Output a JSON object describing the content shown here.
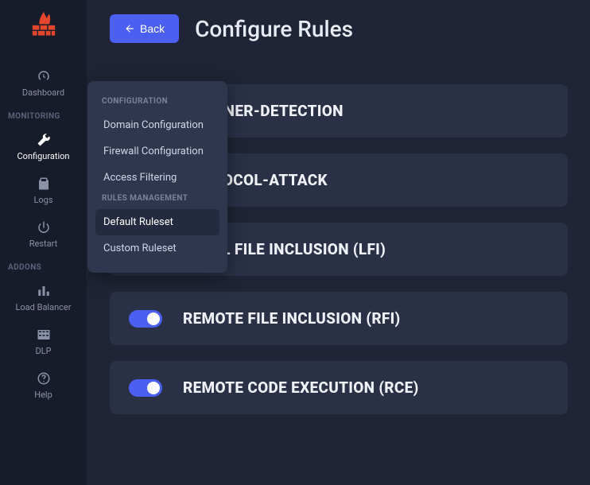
{
  "sidebar": {
    "items": [
      {
        "label": "Dashboard"
      },
      {
        "label": "Configuration"
      },
      {
        "label": "Logs"
      },
      {
        "label": "Restart"
      },
      {
        "label": "Load Balancer"
      },
      {
        "label": "DLP"
      },
      {
        "label": "Help"
      }
    ],
    "sections": {
      "monitoring": "MONITORING",
      "addons": "ADDONS"
    }
  },
  "header": {
    "back_label": "Back",
    "title": "Configure Rules"
  },
  "rules": [
    {
      "name": "SCANNER-DETECTION",
      "enabled": true
    },
    {
      "name": "PROTOCOL-ATTACK",
      "enabled": true
    },
    {
      "name": "LOCAL FILE INCLUSION (LFI)",
      "enabled": true
    },
    {
      "name": "REMOTE FILE INCLUSION (RFI)",
      "enabled": true
    },
    {
      "name": "REMOTE CODE EXECUTION (RCE)",
      "enabled": true
    }
  ],
  "popover": {
    "sections": {
      "configuration": "CONFIGURATION",
      "rules_management": "RULES MANAGEMENT"
    },
    "config_items": [
      "Domain Configuration",
      "Firewall Configuration",
      "Access Filtering"
    ],
    "rules_items": [
      "Default Ruleset",
      "Custom Ruleset"
    ],
    "selected": "Default Ruleset"
  },
  "colors": {
    "accent": "#4b60f3",
    "logo": "#e4472b"
  }
}
